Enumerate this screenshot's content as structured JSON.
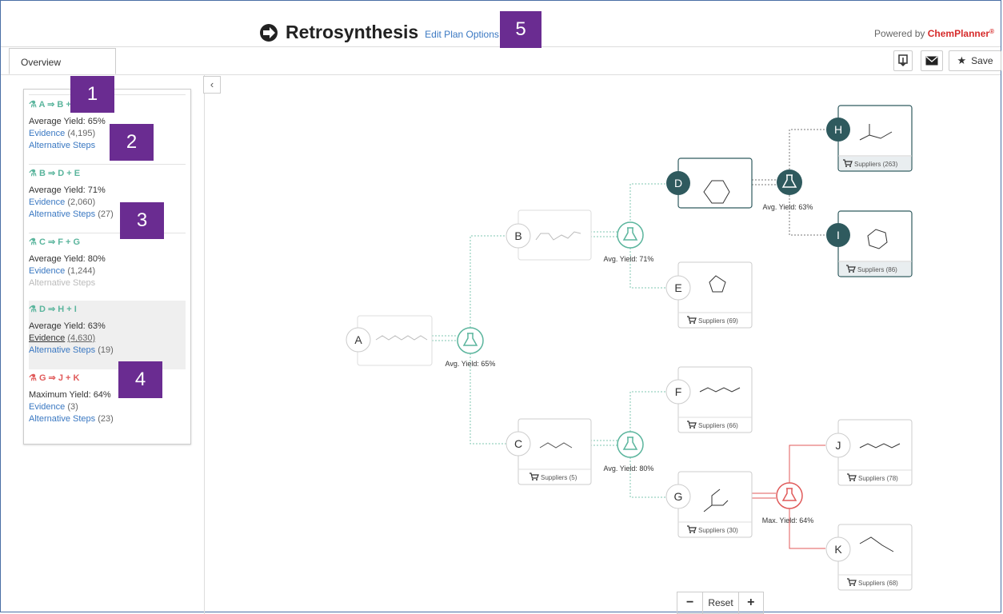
{
  "header": {
    "title": "Retrosynthesis",
    "edit_link": "Edit Plan Options",
    "powered_prefix": "Powered by ",
    "powered_brand": "ChemPlanner",
    "powered_mark": "®"
  },
  "badges": [
    "1",
    "2",
    "3",
    "4",
    "5"
  ],
  "tabs": {
    "overview": "Overview"
  },
  "toolbar": {
    "save_label": "Save"
  },
  "steps": [
    {
      "head": "A ⇒ B + C",
      "yield_label": "Average Yield: 65%",
      "evidence_label": "Evidence",
      "evidence_count": "(4,195)",
      "alt_label": "Alternative Steps",
      "alt_count": "",
      "alt_disabled": false,
      "color": "#5bb59d"
    },
    {
      "head": "B ⇒ D + E",
      "yield_label": "Average Yield: 71%",
      "evidence_label": "Evidence",
      "evidence_count": "(2,060)",
      "alt_label": "Alternative Steps",
      "alt_count": "(27)",
      "alt_disabled": false,
      "color": "#5bb59d"
    },
    {
      "head": "C ⇒ F + G",
      "yield_label": "Average Yield: 80%",
      "evidence_label": "Evidence",
      "evidence_count": "(1,244)",
      "alt_label": "Alternative Steps",
      "alt_count": "",
      "alt_disabled": true,
      "color": "#5bb59d"
    },
    {
      "head": "D ⇒ H + I",
      "yield_label": "Average Yield: 63%",
      "evidence_label": "Evidence",
      "evidence_count": "(4,630)",
      "alt_label": "Alternative Steps",
      "alt_count": "(19)",
      "alt_disabled": false,
      "color": "#5bb59d"
    },
    {
      "head": "G ⇒ J + K",
      "yield_label": "Maximum Yield: 64%",
      "evidence_label": "Evidence",
      "evidence_count": "(3)",
      "alt_label": "Alternative Steps",
      "alt_count": "(23)",
      "alt_disabled": false,
      "color": "#e05a5a"
    }
  ],
  "nodes": {
    "A": {
      "letter": "A"
    },
    "B": {
      "letter": "B"
    },
    "C": {
      "letter": "C",
      "suppliers": "Suppliers (5)"
    },
    "D": {
      "letter": "D"
    },
    "E": {
      "letter": "E",
      "suppliers": "Suppliers (69)"
    },
    "F": {
      "letter": "F",
      "suppliers": "Suppliers (66)"
    },
    "G": {
      "letter": "G",
      "suppliers": "Suppliers (30)"
    },
    "H": {
      "letter": "H",
      "suppliers": "Suppliers (263)"
    },
    "I": {
      "letter": "I",
      "suppliers": "Suppliers (86)"
    },
    "J": {
      "letter": "J",
      "suppliers": "Suppliers (78)"
    },
    "K": {
      "letter": "K",
      "suppliers": "Suppliers (68)"
    }
  },
  "reactions": {
    "r1": "Avg. Yield: 65%",
    "r2": "Avg. Yield: 71%",
    "r3": "Avg. Yield: 80%",
    "r4": "Avg. Yield: 63%",
    "r5": "Max. Yield: 64%"
  },
  "zoom": {
    "minus": "−",
    "reset": "Reset",
    "plus": "+"
  },
  "colors": {
    "green": "#5bb59d",
    "red": "#e05a5a",
    "dark_node": "#2f5a5e",
    "badge": "#6a2c91",
    "link": "#3a78c2"
  }
}
